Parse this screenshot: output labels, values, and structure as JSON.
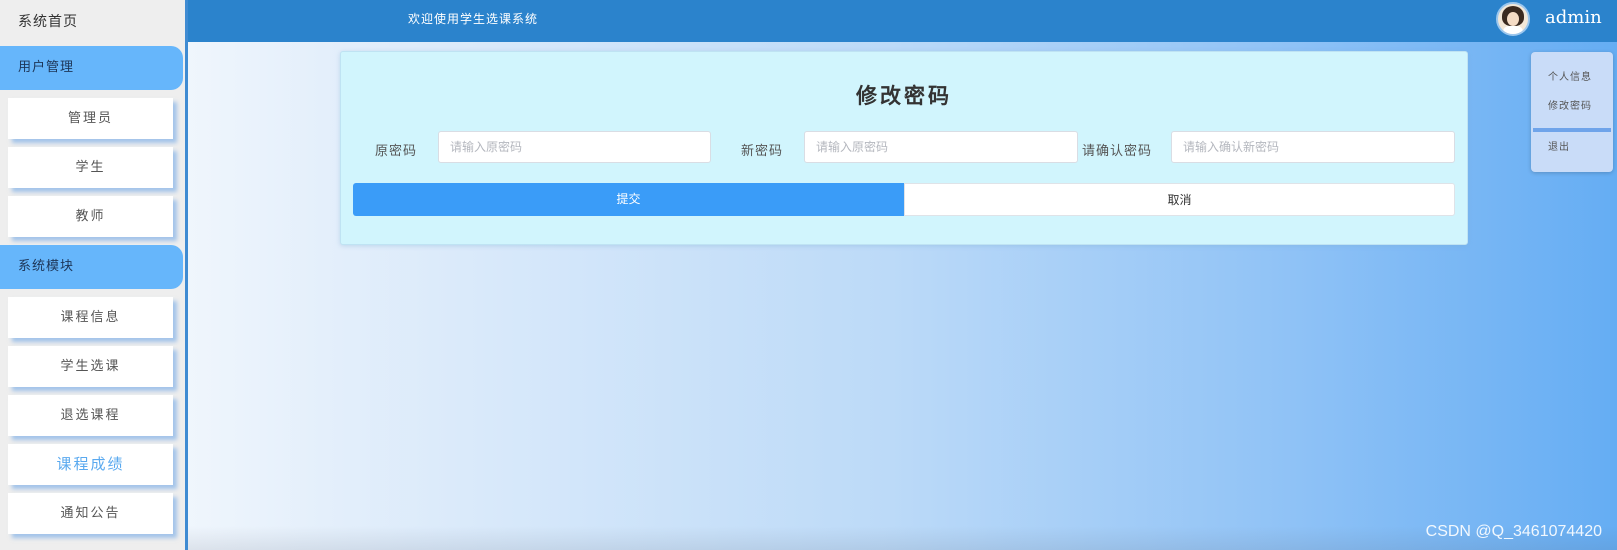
{
  "sidebar": {
    "home": "系统首页",
    "groups": [
      {
        "label": "用户管理",
        "items": [
          "管理员",
          "学生",
          "教师"
        ]
      },
      {
        "label": "系统模块",
        "items": [
          "课程信息",
          "学生选课",
          "退选课程",
          "课程成绩",
          "通知公告"
        ]
      }
    ],
    "active_item": "课程成绩"
  },
  "header": {
    "welcome": "欢迎使用学生选课系统",
    "username": "admin",
    "avatar_icon": "user-avatar-icon"
  },
  "user_menu": {
    "profile": "个人信息",
    "change_password": "修改密码",
    "logout": "退出"
  },
  "form": {
    "title": "修改密码",
    "old_password": {
      "label": "原密码",
      "placeholder": "请输入原密码"
    },
    "new_password": {
      "label": "新密码",
      "placeholder": "请输入原密码"
    },
    "confirm_password": {
      "label": "请确认密码",
      "placeholder": "请输入确认新密码"
    },
    "submit": "提交",
    "cancel": "取消"
  },
  "watermark": "CSDN @Q_3461074420",
  "colors": {
    "header": "#2b83cc",
    "group": "#66b6fb",
    "submit": "#3a9cf8",
    "card": "#d1f5fd"
  }
}
